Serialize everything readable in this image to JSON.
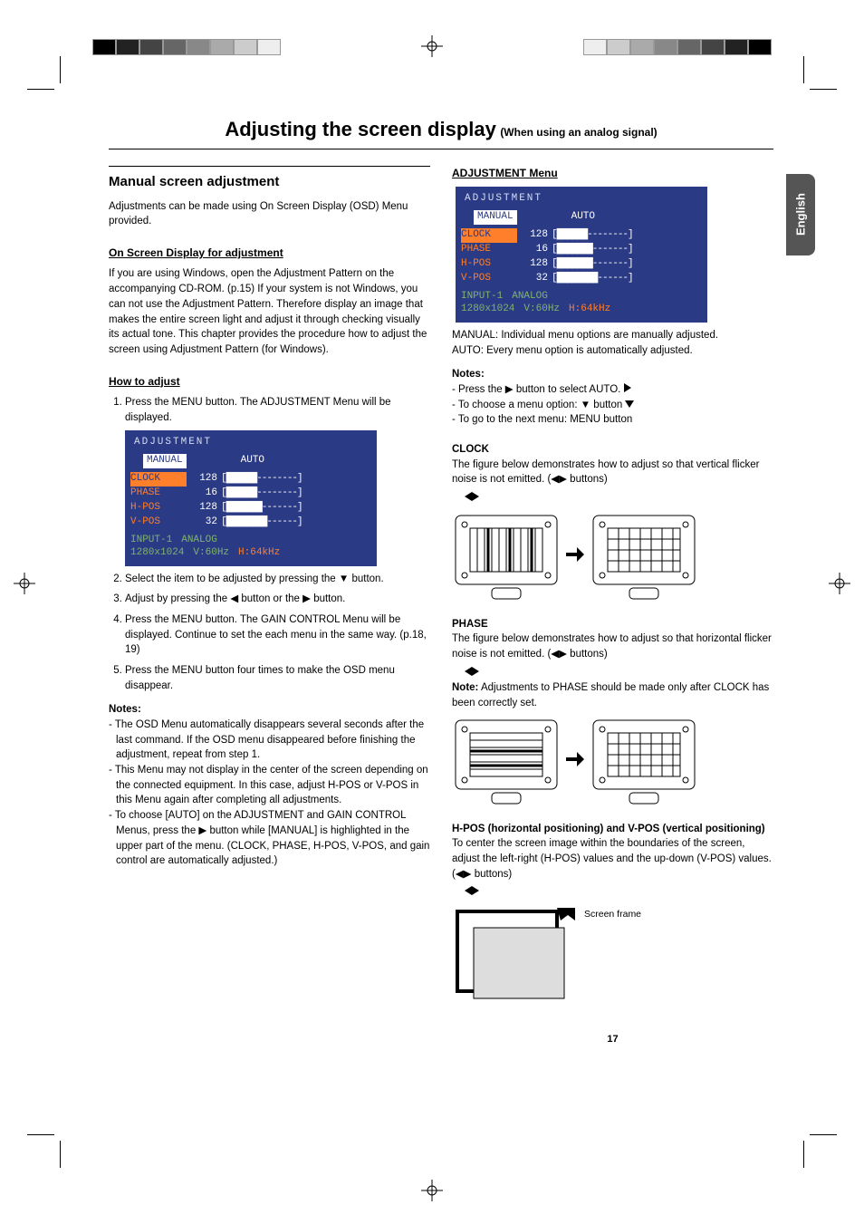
{
  "title_main": "Adjusting the screen display",
  "title_sub": "(When using an analog signal)",
  "lang_tab": "English",
  "left": {
    "h1": "Manual screen adjustment",
    "intro": "Adjustments can be made using On Screen Display (OSD) Menu provided.",
    "osd_h": "On Screen Display for adjustment",
    "osd_desc": "If you are using Windows, open the Adjustment Pattern on the accompanying CD-ROM. (p.15) If your system is not Windows, you can not use the Adjustment Pattern. Therefore display an image that makes the entire screen light and adjust it through checking visually its actual tone. This chapter provides the procedure how to adjust the screen using Adjustment Pattern (for Windows).",
    "how_h": "How to adjust",
    "steps": [
      "Press the MENU button. The ADJUSTMENT Menu will be displayed.",
      "Select the item to be adjusted by pressing the ▼ button.",
      "Adjust by pressing the ◀ button or the ▶ button.",
      "Press the MENU button. The GAIN CONTROL Menu will be displayed. Continue to set the each menu in the same way. (p.18, 19)",
      "Press the MENU button four times to make the OSD menu disappear."
    ],
    "notes_h": "Notes:",
    "notes": [
      "The OSD Menu automatically disappears several seconds after the last command. If the OSD menu disappeared before finishing the adjustment, repeat from step 1.",
      "This Menu may not display in the center of the screen depending on the connected equipment. In this case, adjust H-POS or V-POS in this Menu again after completing all adjustments.",
      "To choose [AUTO] on the ADJUSTMENT and GAIN CONTROL Menus, press the ▶ button while [MANUAL] is highlighted in the upper part of the menu. (CLOCK, PHASE, H-POS, V-POS, and gain control are automatically adjusted.)"
    ]
  },
  "right": {
    "adj_h": "ADJUSTMENT Menu",
    "adj_desc1": "MANUAL: Individual menu options are manually adjusted.",
    "adj_desc2": "AUTO: Every menu option is automatically adjusted.",
    "notes_h": "Notes:",
    "adj_notes": [
      "Press the ▶ button to select AUTO.",
      "To choose a menu option: ▼ button",
      "To go to the next menu: MENU button"
    ],
    "clock_h": "CLOCK",
    "clock_txt": "The figure below demonstrates how to adjust so that vertical flicker noise is not emitted. (◀▶ buttons)",
    "phase_h": "PHASE",
    "phase_txt": "The figure below demonstrates how to adjust so that horizontal flicker noise is not emitted. (◀▶ buttons)",
    "phase_note_h": "Note:",
    "phase_note": "Adjustments to PHASE should be made only after CLOCK has been correctly set.",
    "hpos_h": "H-POS (horizontal positioning) and V-POS (vertical positioning)",
    "hpos_txt": "To center the screen image within the boundaries of the screen, adjust the left-right (H-POS) values and the up-down (V-POS) values. (◀▶ buttons)",
    "frame_label": "Screen frame"
  },
  "osd": {
    "title": "ADJUSTMENT",
    "tab_manual": "MANUAL",
    "tab_auto": "AUTO",
    "rows": [
      {
        "label": "CLOCK",
        "value": "128"
      },
      {
        "label": "PHASE",
        "value": "16"
      },
      {
        "label": "H-POS",
        "value": "128"
      },
      {
        "label": "V-POS",
        "value": "32"
      }
    ],
    "status": {
      "input": "INPUT-1",
      "res": "1280x1024",
      "mode": "ANALOG",
      "v": "V:60Hz",
      "h": "H:64kHz"
    }
  },
  "page_number": "17"
}
